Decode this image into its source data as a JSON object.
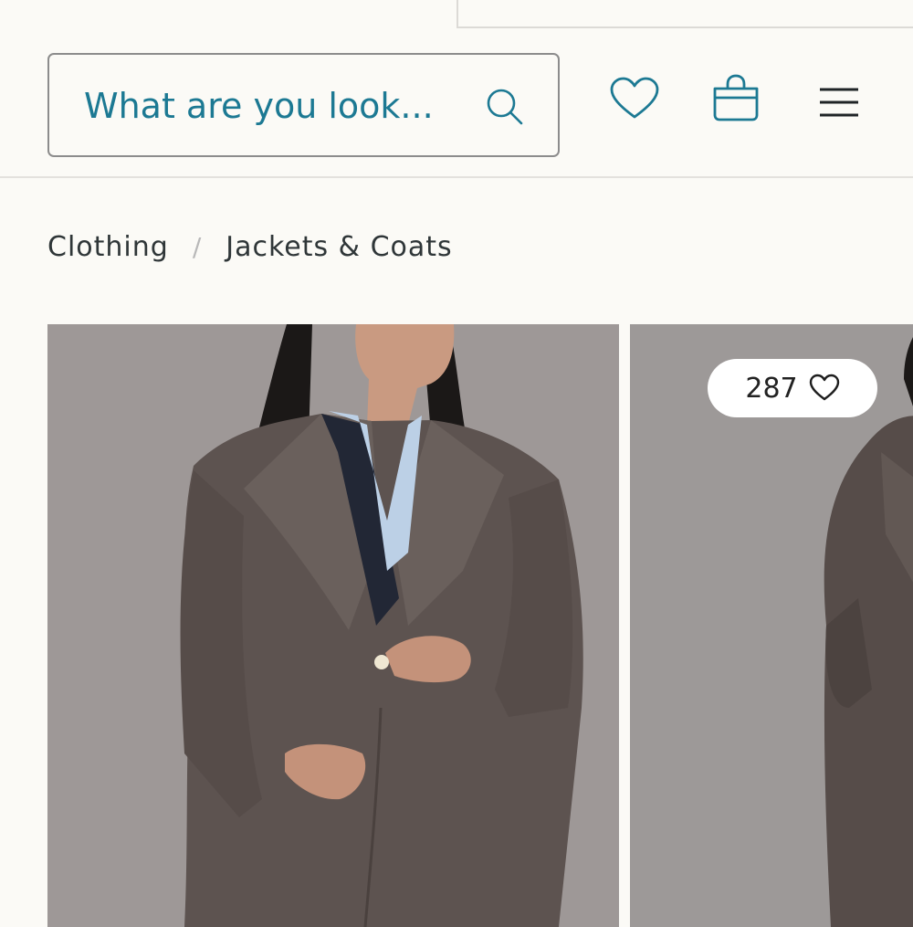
{
  "header": {
    "search": {
      "placeholder": "What are you look..."
    },
    "icons": [
      "search-icon",
      "heart-icon",
      "shopping-bag-icon",
      "hamburger-menu-icon"
    ]
  },
  "breadcrumb": {
    "items": [
      "Clothing",
      "Jackets & Coats"
    ],
    "separator": "/"
  },
  "products": [
    {
      "image_alt": ""
    },
    {
      "likes": "287"
    }
  ],
  "colors": {
    "accent": "#1c7993",
    "background": "#fbfaf6",
    "text": "#2f3638"
  }
}
